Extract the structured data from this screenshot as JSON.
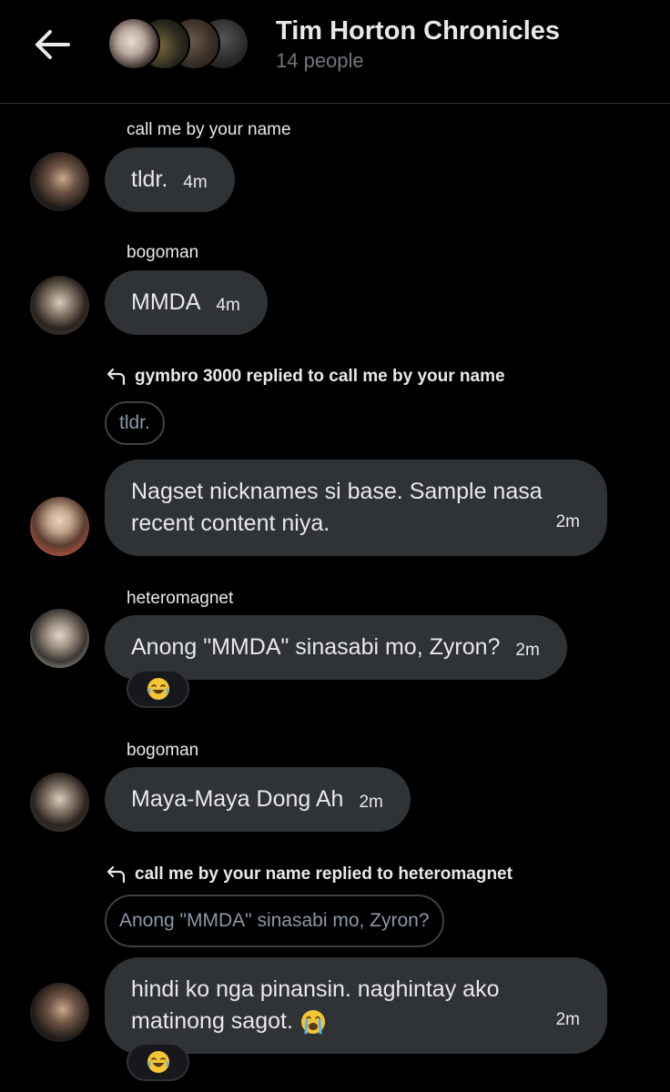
{
  "header": {
    "title": "Tim Horton Chronicles",
    "subtitle": "14 people"
  },
  "messages": [
    {
      "sender": "call me by your name",
      "text": "tldr.",
      "time": "4m"
    },
    {
      "sender": "bogoman",
      "text": "MMDA",
      "time": "4m"
    },
    {
      "reply_info": "gymbro 3000 replied to call me by your name",
      "quoted": "tldr.",
      "line1": "Nagset nicknames si base. Sample nasa",
      "line2": "recent content niya.",
      "time": "2m"
    },
    {
      "sender": "heteromagnet",
      "text": "Anong \"MMDA\" sinasabi mo, Zyron?",
      "time": "2m",
      "reaction": "laughing-emoji"
    },
    {
      "sender": "bogoman",
      "text": "Maya-Maya Dong Ah",
      "time": "2m"
    },
    {
      "reply_info": "call me by your name replied to heteromagnet",
      "quoted": "Anong \"MMDA\" sinasabi mo, Zyron?",
      "line1": "hindi ko nga pinansin. naghintay ako",
      "line2": "matinong sagot.",
      "time": "2m",
      "inline_emoji": "crying-emoji",
      "reaction": "laughing-emoji"
    }
  ],
  "colors": {
    "background": "#000000",
    "bubble": "#2f3336",
    "muted": "#71767b"
  }
}
